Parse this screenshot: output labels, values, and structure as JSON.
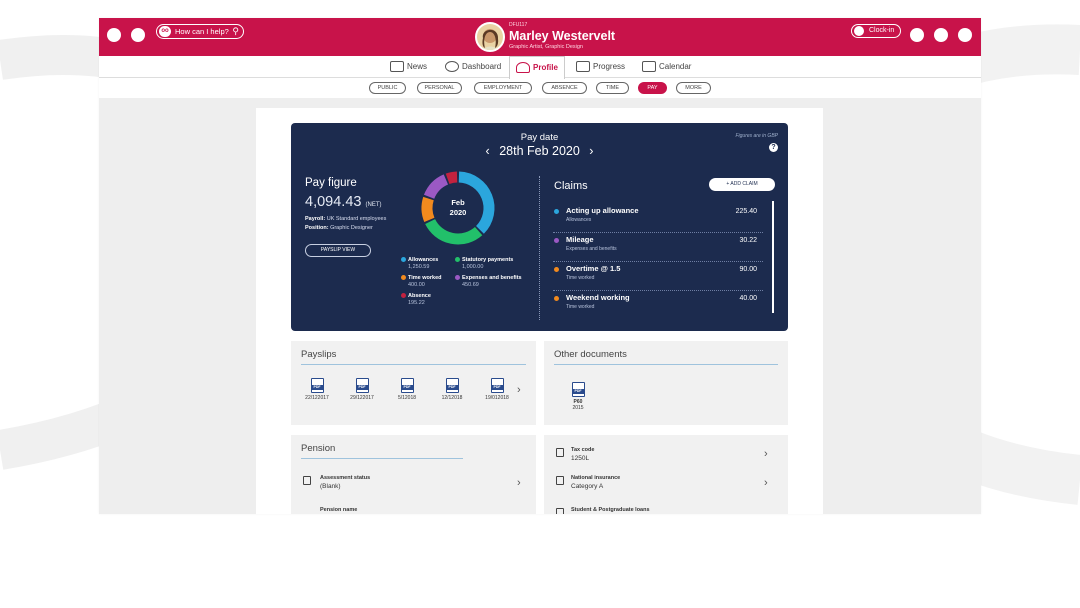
{
  "header": {
    "help_placeholder": "How can I help?",
    "user_code": "DFU117",
    "user_name": "Marley Westervelt",
    "user_role": "Graphic Artist, Graphic Design",
    "clock_in": "Clock-in"
  },
  "nav": {
    "tabs": [
      {
        "label": "News",
        "icon": "news-icon"
      },
      {
        "label": "Dashboard",
        "icon": "star-icon"
      },
      {
        "label": "Profile",
        "icon": "person-icon",
        "active": true
      },
      {
        "label": "Progress",
        "icon": "chart-icon"
      },
      {
        "label": "Calendar",
        "icon": "calendar-icon"
      }
    ]
  },
  "subnav": {
    "pills": [
      "PUBLIC",
      "PERSONAL",
      "EMPLOYMENT",
      "ABSENCE",
      "TIME",
      "PAY",
      "MORE"
    ],
    "active": "PAY"
  },
  "pay": {
    "title": "Pay date",
    "date": "28th Feb 2020",
    "figures_note": "Figures are in GBP",
    "figure_label": "Pay figure",
    "figure_value": "4,094.43",
    "figure_unit": "(NET)",
    "payroll_label": "Payroll:",
    "payroll_value": "UK Standard employees",
    "position_label": "Position:",
    "position_value": "Graphic Designer",
    "payslip_button": "PAYSLIP VIEW",
    "donut_center_1": "Feb",
    "donut_center_2": "2020"
  },
  "chart_data": {
    "type": "pie",
    "variant": "donut",
    "title": "",
    "categories": [
      "Allowances",
      "Statutory payments",
      "Time worked",
      "Expenses and benefits",
      "Absence"
    ],
    "values": [
      1250.59,
      1000.0,
      400.0,
      450.69,
      195.22
    ],
    "value_labels": [
      "1,250.59",
      "1,000.00",
      "400.00",
      "450.69",
      "195.22"
    ],
    "colors": [
      "#2ba6dd",
      "#22c06a",
      "#f28a1e",
      "#9b59c4",
      "#c2223f"
    ],
    "legend_placement": "bottom"
  },
  "claims": {
    "title": "Claims",
    "add_button": "+ ADD CLAIM",
    "items": [
      {
        "name": "Acting up allowance",
        "sub": "Allowances",
        "amount": "225.40",
        "color": "#2ba6dd"
      },
      {
        "name": "Mileage",
        "sub": "Expenses and benefits",
        "amount": "30.22",
        "color": "#9b59c4"
      },
      {
        "name": "Overtime @ 1.5",
        "sub": "Time worked",
        "amount": "90.00",
        "color": "#f28a1e"
      },
      {
        "name": "Weekend working",
        "sub": "Time worked",
        "amount": "40.00",
        "color": "#f28a1e"
      }
    ]
  },
  "payslips": {
    "title": "Payslips",
    "items": [
      "22/122017",
      "29/122017",
      "5/12018",
      "12/12018",
      "19/012018"
    ],
    "icon_label": "PDF"
  },
  "other_docs": {
    "title": "Other documents",
    "items": [
      {
        "name": "P60",
        "year": "2015"
      }
    ]
  },
  "pension": {
    "title": "Pension",
    "rows": [
      {
        "label": "Assessment status",
        "value": "(Blank)"
      },
      {
        "label": "Pension name",
        "value": ""
      }
    ]
  },
  "tax": {
    "rows": [
      {
        "label": "Tax code",
        "value": "1250L"
      },
      {
        "label": "National insurance",
        "value": "Category A"
      },
      {
        "label": "Student & Postgraduate loans",
        "value": ""
      }
    ]
  }
}
